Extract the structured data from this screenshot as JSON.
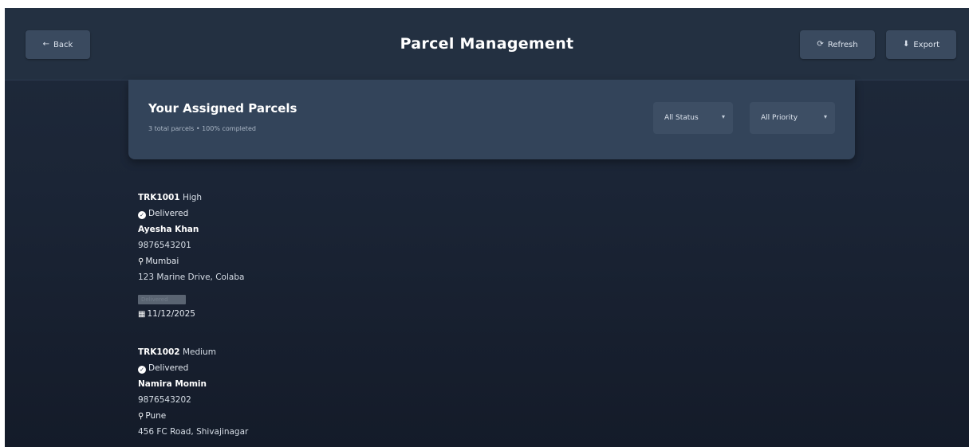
{
  "header": {
    "back_label": "Back",
    "back_icon": "arrow-left-icon",
    "title": "Parcel Management",
    "refresh_label": "Refresh",
    "refresh_icon": "refresh-icon",
    "export_label": "Export",
    "export_icon": "download-icon"
  },
  "panel": {
    "title": "Your Assigned Parcels",
    "subtitle": "3 total parcels • 100% completed",
    "status_filter": "All Status",
    "priority_filter": "All Priority"
  },
  "parcels": [
    {
      "tracking": "TRK1001",
      "priority": "High",
      "status": "Delivered",
      "name": "Ayesha Khan",
      "phone": "9876543201",
      "city": "Mumbai",
      "address": "123 Marine Drive, Colaba",
      "chip": "Delivered",
      "date": "11/12/2025"
    },
    {
      "tracking": "TRK1002",
      "priority": "Medium",
      "status": "Delivered",
      "name": "Namira Momin",
      "phone": "9876543202",
      "city": "Pune",
      "address": "456 FC Road, Shivajinagar"
    }
  ],
  "colors": {
    "background": "#1b2536",
    "topbar": "#233041",
    "panel": "#33445a",
    "button": "#3a4a5f"
  }
}
